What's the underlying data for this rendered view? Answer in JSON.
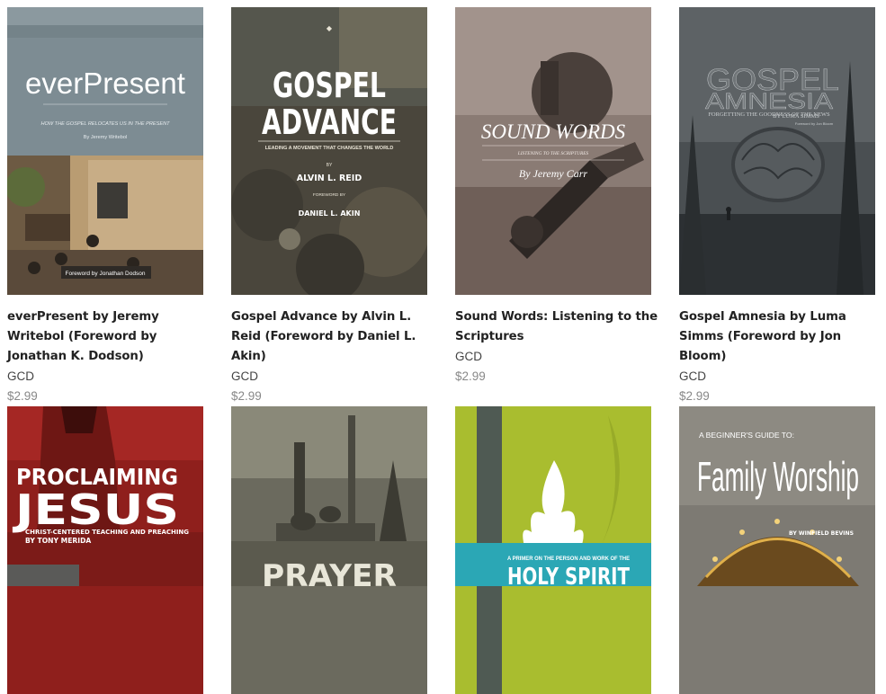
{
  "books": [
    {
      "title": "everPresent by Jeremy Writebol (Foreword by Jonathan K. Dodson)",
      "publisher": "GCD",
      "price": "$2.99",
      "cover": {
        "headline": "everPresent",
        "tagline": "HOW THE GOSPEL RELOCATES US IN THE PRESENT",
        "author": "By Jeremy Writebol",
        "foreword": "Foreword by Jonathan Dodson"
      }
    },
    {
      "title": "Gospel Advance by Alvin L. Reid (Foreword by Daniel L. Akin)",
      "publisher": "GCD",
      "price": "$2.99",
      "cover": {
        "line1": "GOSPEL",
        "line2": "ADVANCE",
        "tagline": "LEADING A MOVEMENT THAT CHANGES THE WORLD",
        "by": "BY",
        "author": "ALVIN L. REID",
        "foreword_by": "FOREWORD BY",
        "foreword": "DANIEL L. AKIN"
      }
    },
    {
      "title": "Sound Words: Listening to the Scriptures",
      "publisher": "GCD",
      "price": "$2.99",
      "cover": {
        "headline": "SOUND WORDS",
        "tagline": "LISTENING TO THE SCRIPTURES",
        "author": "By Jeremy Carr"
      }
    },
    {
      "title": "Gospel Amnesia by Luma Simms (Foreword by Jon Bloom)",
      "publisher": "GCD",
      "price": "$2.99",
      "cover": {
        "line1": "GOSPEL",
        "line2": "AMNESIA",
        "tagline": "FORGETTING THE GOODNESS OF THE NEWS",
        "author": "BY LUMA SIMMS",
        "foreword": "Foreword by Jon Bloom"
      }
    },
    {
      "cover": {
        "line1": "PROCLAIMING",
        "line2": "JESUS",
        "tagline": "CHRIST-CENTERED TEACHING AND PREACHING",
        "author": "BY TONY MERIDA"
      }
    },
    {
      "cover": {
        "headline": "PRAYER"
      }
    },
    {
      "cover": {
        "tagline": "A PRIMER ON THE PERSON AND WORK OF THE",
        "headline": "HOLY SPIRIT"
      }
    },
    {
      "cover": {
        "kicker": "A BEGINNER'S GUIDE TO:",
        "line1": "Family Worship",
        "author": "BY WINFIELD BEVINS"
      }
    }
  ]
}
